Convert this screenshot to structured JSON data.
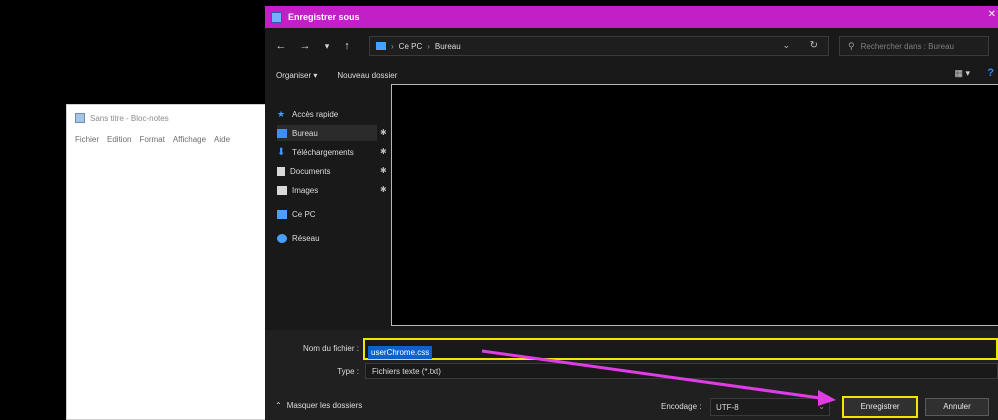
{
  "notepad": {
    "title": "Sans titre - Bloc-notes",
    "menu": [
      "Fichier",
      "Edition",
      "Format",
      "Affichage",
      "Aide"
    ]
  },
  "dialog": {
    "title": "Enregistrer sous",
    "close_glyph": "✕",
    "nav": {
      "back": "←",
      "forward": "→",
      "recent": "▾",
      "up": "↑"
    },
    "breadcrumb": [
      "Ce PC",
      "Bureau"
    ],
    "search_placeholder": "Rechercher dans : Bureau",
    "toolbar": {
      "organize": "Organiser ▾",
      "new_folder": "Nouveau dossier",
      "view_glyph": "▦ ▾",
      "help_glyph": "?"
    },
    "sidebar": {
      "items": [
        {
          "label": "Accès rapide",
          "icon": "star-icon",
          "color": "#3d9bff"
        },
        {
          "label": "Bureau",
          "icon": "desktop-icon",
          "color": "#3d8eff",
          "pinned": true
        },
        {
          "label": "Téléchargements",
          "icon": "download-icon",
          "color": "#3d9bff",
          "pinned": true
        },
        {
          "label": "Documents",
          "icon": "document-icon",
          "color": "#d9d9d9",
          "pinned": true
        },
        {
          "label": "Images",
          "icon": "image-icon",
          "color": "#d9d9d9",
          "pinned": true
        },
        {
          "label": "Ce PC",
          "icon": "computer-icon",
          "color": "#4aa0ff"
        },
        {
          "label": "Réseau",
          "icon": "network-icon",
          "color": "#4aa0ff"
        }
      ],
      "pin_glyph": "✱"
    },
    "fields": {
      "filename_label": "Nom du fichier :",
      "filename_value": "userChrome.css",
      "type_label": "Type :",
      "type_value": "Fichiers texte (*.txt)"
    },
    "footer": {
      "toggle_label": "Masquer les dossiers",
      "toggle_glyph": "⌃",
      "encoding_label": "Encodage :",
      "encoding_value": "UTF-8",
      "save_label": "Enregistrer",
      "cancel_label": "Annuler"
    }
  },
  "colors": {
    "title_bar": "#c21fc7",
    "highlight": "#f2e600",
    "arrow": "#e03ce6",
    "selection": "#0b63c8"
  }
}
